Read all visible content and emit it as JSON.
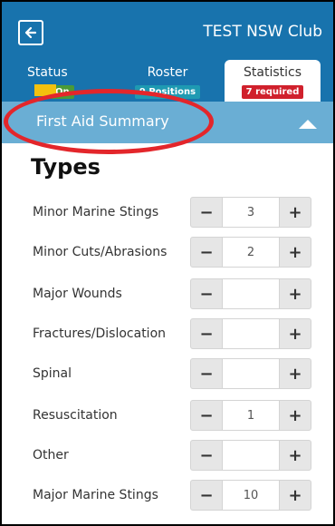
{
  "header": {
    "club_name": "TEST NSW Club",
    "back_icon": "arrow-left-icon"
  },
  "tabs": [
    {
      "label": "Status",
      "badge": "On",
      "badge_color": "#4a9a38"
    },
    {
      "label": "Roster",
      "badge": "9 Positions",
      "badge_color": "#1e9ab2"
    },
    {
      "label": "Statistics",
      "badge": "7 required",
      "badge_color": "#d0202c"
    }
  ],
  "active_tab": "Statistics",
  "section": {
    "title": "First Aid Summary",
    "expanded": true
  },
  "types_title": "Types",
  "rows": [
    {
      "label": "Minor Marine Stings",
      "value": "3"
    },
    {
      "label": "Minor Cuts/Abrasions",
      "value": "2"
    },
    {
      "label": "Major Wounds",
      "value": ""
    },
    {
      "label": "Fractures/Dislocation",
      "value": ""
    },
    {
      "label": "Spinal",
      "value": ""
    },
    {
      "label": "Resuscitation",
      "value": "1"
    },
    {
      "label": "Other",
      "value": ""
    },
    {
      "label": "Major Marine Stings",
      "value": "10"
    }
  ],
  "stepper": {
    "minus": "−",
    "plus": "+"
  },
  "colors": {
    "header_blue": "#1873ad",
    "section_blue": "#6aaed4",
    "highlight_red": "#e3262b"
  }
}
